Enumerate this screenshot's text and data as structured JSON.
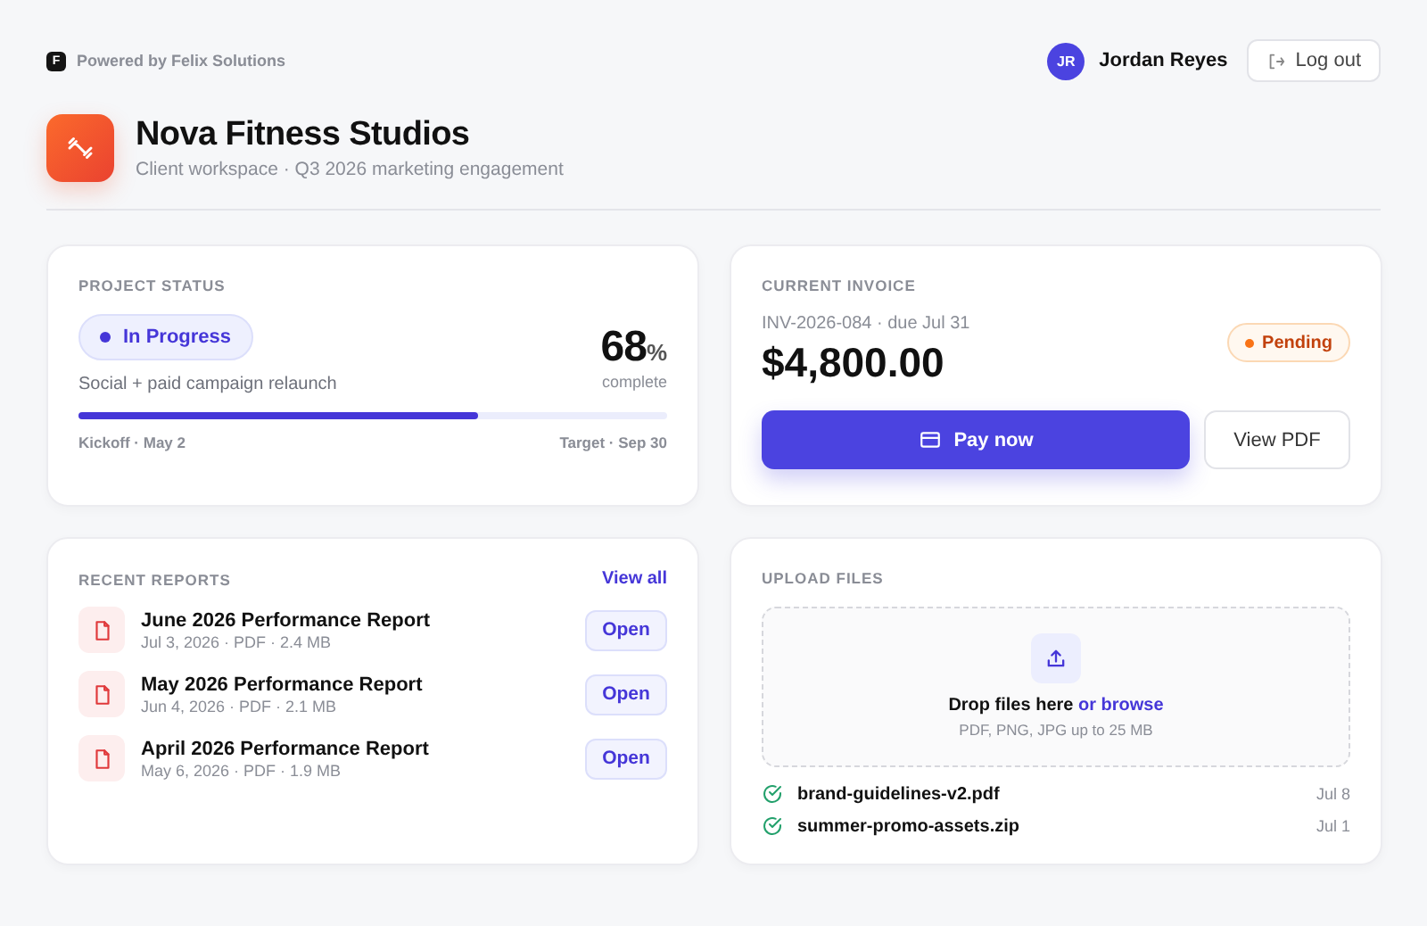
{
  "brand": {
    "powered_by": "Powered by Felix Solutions",
    "logo_letter": "F"
  },
  "user": {
    "initials": "JR",
    "name": "Jordan Reyes",
    "logout": "Log out"
  },
  "client": {
    "name": "Nova Fitness Studios",
    "subtitle": "Client workspace · Q3 2026 marketing engagement"
  },
  "project_status": {
    "heading": "PROJECT STATUS",
    "status": "In Progress",
    "description": "Social + paid campaign relaunch",
    "percent": "68",
    "percent_unit": "%",
    "percent_caption": "complete",
    "level": 0.68,
    "start": "Kickoff · May 2",
    "target": "Target · Sep 30"
  },
  "invoice": {
    "heading": "CURRENT INVOICE",
    "reference": "INV-2026-084 · due Jul 31",
    "amount": "$4,800.00",
    "status": "Pending",
    "pay_button": "Pay now",
    "pdf_button": "View PDF"
  },
  "reports": {
    "heading": "RECENT REPORTS",
    "view_all": "View all",
    "items": [
      {
        "title": "June 2026 Performance Report",
        "meta": "Jul 3, 2026 · PDF · 2.4 MB",
        "action": "Open"
      },
      {
        "title": "May 2026 Performance Report",
        "meta": "Jun 4, 2026 · PDF · 2.1 MB",
        "action": "Open"
      },
      {
        "title": "April 2026 Performance Report",
        "meta": "May 6, 2026 · PDF · 1.9 MB",
        "action": "Open"
      }
    ]
  },
  "upload": {
    "heading": "UPLOAD FILES",
    "drop_text": "Drop files here",
    "browse_link": "or browse",
    "hint": "PDF, PNG, JPG up to 25 MB",
    "files": [
      {
        "name": "brand-guidelines-v2.pdf",
        "date": "Jul 8"
      },
      {
        "name": "summer-promo-assets.zip",
        "date": "Jul 1"
      }
    ]
  }
}
